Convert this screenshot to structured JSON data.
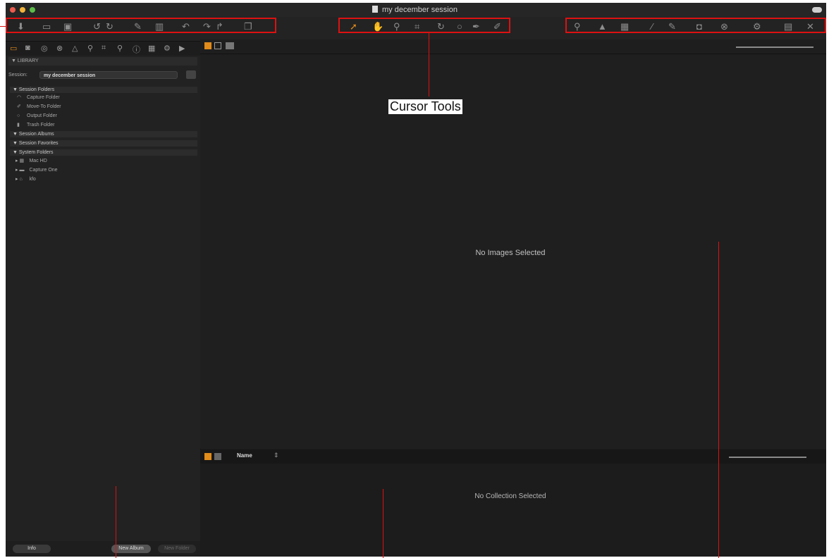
{
  "window": {
    "title": "my december session",
    "traffic_lights": [
      "#ec5b4d",
      "#f3b33a",
      "#5bbd48"
    ]
  },
  "toolbar": {
    "left_group": [
      "import-icon",
      "show-icon",
      "compare-icon",
      "rotate-left-icon",
      "rotate-right-icon",
      "edit-icon",
      "delete-icon",
      "undo-icon",
      "redo-icon",
      "redo-alt-icon",
      "copy-icon"
    ],
    "cursor_tools": [
      "select-icon",
      "pan-icon",
      "zoom-icon",
      "crop-icon",
      "rotate-icon",
      "keystone-icon",
      "pick-color-icon",
      "brush-icon"
    ],
    "right_group": [
      "search-icon",
      "warning-icon",
      "grid-icon",
      "levels-icon",
      "pipette-icon",
      "camera-icon",
      "lens-icon",
      "settings-icon",
      "info-icon",
      "tools-icon"
    ],
    "colors": {
      "callout": "#d11111",
      "accent": "#e08b1a"
    }
  },
  "sidebar": {
    "tab_icons": [
      "folder-icon",
      "camera-icon",
      "capture-icon",
      "lens-icon",
      "triangle-icon",
      "pin-icon",
      "crop-icon",
      "search-icon",
      "info-icon",
      "grid-icon",
      "gear-icon",
      "play-icon"
    ],
    "library_label": "LIBRARY",
    "session_label": "Session:",
    "session_value": "my december session",
    "sections": {
      "session_folders": "Session Folders",
      "session_albums": "Session Albums",
      "session_favorites": "Session Favorites",
      "system_folders": "System Folders"
    },
    "session_items": [
      {
        "icon": "capture-folder-icon",
        "label": "Capture Folder"
      },
      {
        "icon": "move-to-folder-icon",
        "label": "Move-To Folder"
      },
      {
        "icon": "output-folder-icon",
        "label": "Output Folder"
      },
      {
        "icon": "trash-folder-icon",
        "label": "Trash Folder"
      }
    ],
    "system_items": [
      {
        "icon": "hard-drive-icon",
        "label": "Mac HD"
      },
      {
        "icon": "folder-icon",
        "label": "Capture One"
      },
      {
        "icon": "user-home-icon",
        "label": "kfo"
      }
    ],
    "bottom": {
      "info_button": "Info",
      "new_album_button": "New Album",
      "new_folder_button": "New Folder"
    }
  },
  "viewer": {
    "empty_text": "No Images Selected",
    "view_mode_icons": [
      "grid-view-icon",
      "single-view-icon",
      "multi-view-icon"
    ]
  },
  "browser": {
    "sort_label": "Name",
    "empty_text": "No Collection Selected"
  },
  "annotations": {
    "cursor_tools_label": "Cursor Tools"
  }
}
